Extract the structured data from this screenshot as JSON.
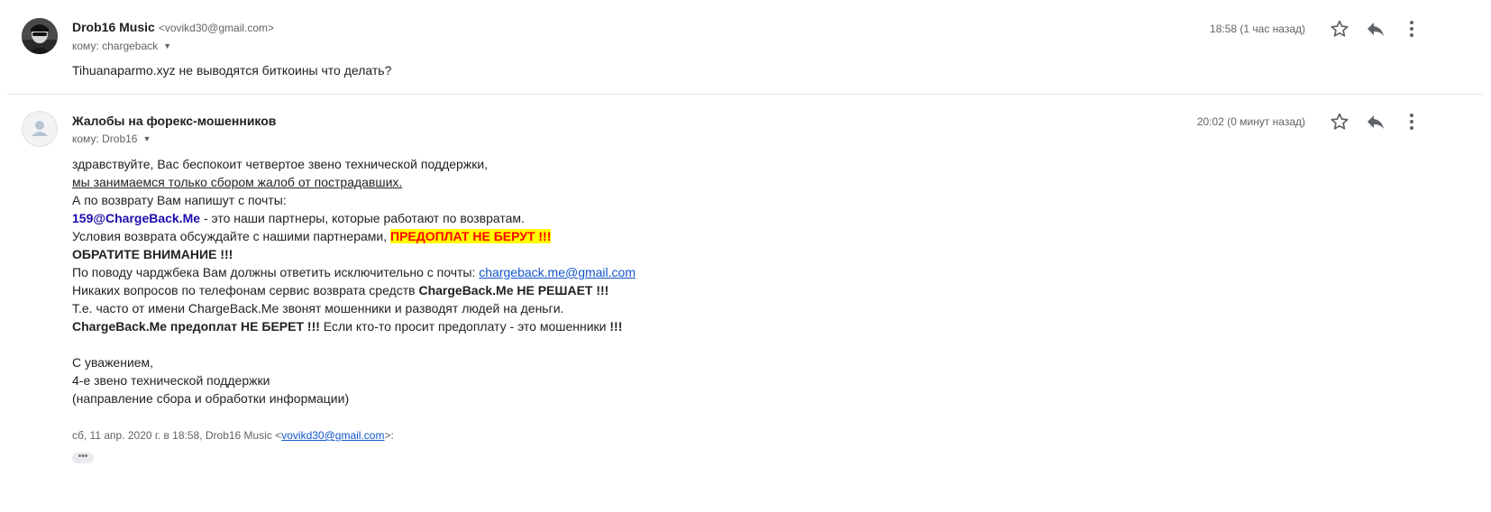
{
  "message1": {
    "sender_name": "Drob16 Music",
    "sender_email": "<vovikd30@gmail.com>",
    "recipient_label": "кому: chargeback",
    "time": "18:58 (1 час назад)",
    "snippet": "Tihuanaparmo.xyz не выводятся биткоины что делать?",
    "avatar_icon": "user-photo-icon"
  },
  "message2": {
    "sender_name": "Жалобы на форекс-мошенников",
    "recipient_label": "кому: Drob16",
    "time": "20:02 (0 минут назад)",
    "avatar_icon": "generic-person-icon",
    "body": {
      "l1": "здравствуйте, Вас беспокоит четвертое звено технической поддержки,",
      "l2": "мы занимаемся только сбором жалоб от пострадавших.",
      "l3": "А по возврату Вам напишут с почты:",
      "l4_email": "159@ChargeBack.Me",
      "l4_rest": " - это наши партнеры, которые работают по возвратам.",
      "l5_text": "Условия возврата обсуждайте с нашими партнерами, ",
      "l5_highlight": "ПРЕДОПЛАТ НЕ БЕРУТ !!!",
      "l6": "ОБРАТИТЕ ВНИМАНИЕ !!!",
      "l7_text": "По поводу чарджбека Вам должны ответить исключительно с почты: ",
      "l7_link": "chargeback.me@gmail.com",
      "l8_text": "Никаких вопросов по телефонам сервис возврата средств ",
      "l8_bold": "ChargeBack.Me НЕ РЕШАЕТ !!!",
      "l9": "Т.е. часто от имени ChargeBack.Me звонят мошенники и разводят людей на деньги.",
      "l10_bold": "ChargeBack.Me предоплат НЕ БЕРЕТ !!!",
      "l10_text": " Если кто-то просит предоплату - это мошенники ",
      "l10_end": "!!!",
      "sig1": "С уважением,",
      "sig2": "4-е звено технической поддержки",
      "sig3": "(направление сбора и обработки информации)"
    },
    "quote_prefix": "сб, 11 апр. 2020 г. в 18:58, Drob16 Music <",
    "quote_email": "vovikd30@gmail.com",
    "quote_suffix": ">:",
    "show_trimmed": "•••"
  },
  "icons": {
    "star": "star-outline-icon",
    "reply": "reply-icon",
    "more": "more-vert-icon",
    "caret": "caret-down-icon"
  },
  "colors": {
    "link": "#1155cc",
    "highlight_bg": "#ffff00",
    "highlight_fg": "#ff0000",
    "email_blue": "#1a0dab"
  }
}
